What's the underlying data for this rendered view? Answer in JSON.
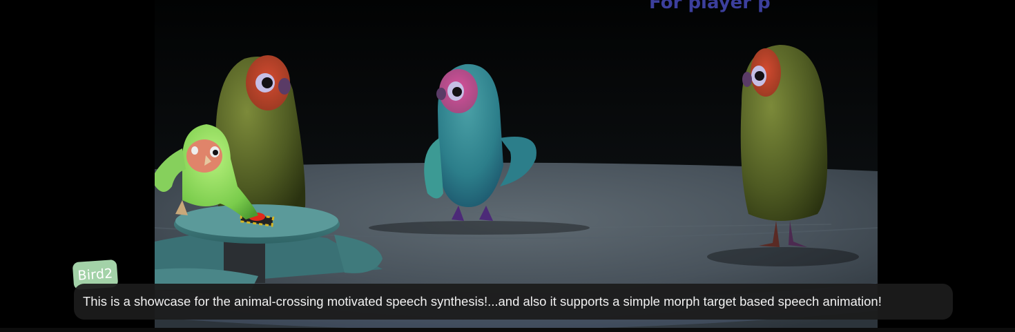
{
  "scene": {
    "banner_text": "For player p"
  },
  "dialogue": {
    "speaker": "Bird2",
    "text": "This is a showcase for the animal-crossing motivated speech synthesis!...and also it supports a simple morph target based speech animation!"
  },
  "colors": {
    "name_tag": "#a3d2a8",
    "dialogue_box": "#1c1c1c",
    "banner": "#3c3f9c"
  }
}
